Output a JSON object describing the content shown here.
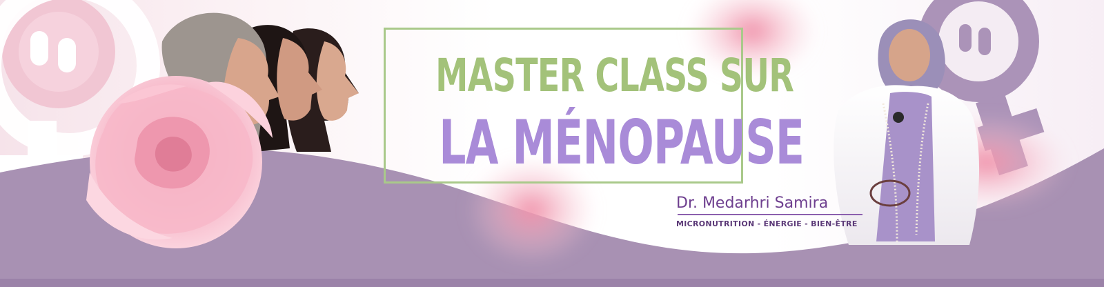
{
  "title": {
    "line1": "MASTER CLASS SUR",
    "line2": "LA MÉNOPAUSE"
  },
  "presenter": {
    "name": "Dr. Medarhri Samira",
    "tagline": "MICRONUTRITION - ÉNERGIE - BIEN-ÊTRE"
  },
  "colors": {
    "title_green": "#a3c27a",
    "title_purple": "#a98bd8",
    "wave_purple": "#a891b3",
    "name_purple": "#6e3f8f",
    "rose_pink": "#f2a7bf"
  },
  "icons": [
    "female-symbol-icon",
    "rose-flower",
    "women-profiles-photo",
    "doctor-portrait-photo"
  ]
}
